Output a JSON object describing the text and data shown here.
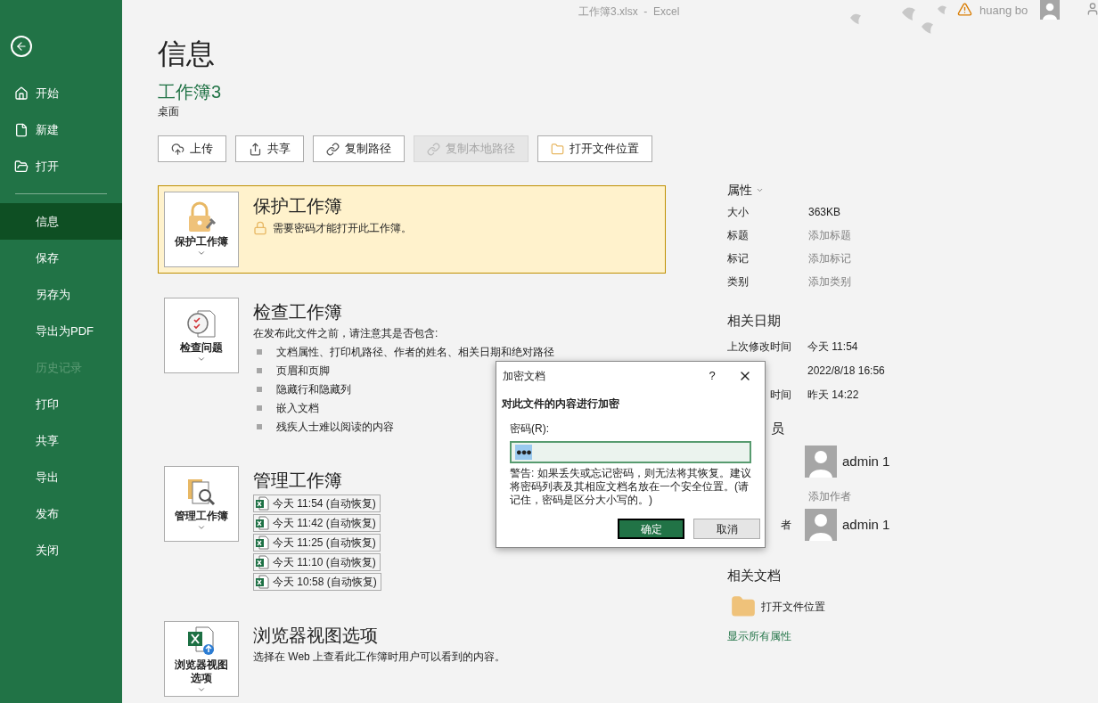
{
  "title_bar": {
    "document_title": "工作簿3.xlsx  -  Excel",
    "user_name": "huang bo"
  },
  "sidebar": {
    "top_items": [
      {
        "label": "开始"
      },
      {
        "label": "新建"
      },
      {
        "label": "打开"
      }
    ],
    "items": [
      {
        "label": "信息",
        "selected": true,
        "disabled": false
      },
      {
        "label": "保存",
        "selected": false,
        "disabled": false
      },
      {
        "label": "另存为",
        "selected": false,
        "disabled": false
      },
      {
        "label": "导出为PDF",
        "selected": false,
        "disabled": false
      },
      {
        "label": "历史记录",
        "selected": false,
        "disabled": true
      },
      {
        "label": "打印",
        "selected": false,
        "disabled": false
      },
      {
        "label": "共享",
        "selected": false,
        "disabled": false
      },
      {
        "label": "导出",
        "selected": false,
        "disabled": false
      },
      {
        "label": "发布",
        "selected": false,
        "disabled": false
      },
      {
        "label": "关闭",
        "selected": false,
        "disabled": false
      }
    ]
  },
  "page_title": "信息",
  "workbook": {
    "name": "工作簿3",
    "location": "桌面"
  },
  "actions": [
    {
      "label": "上传",
      "disabled": false
    },
    {
      "label": "共享",
      "disabled": false
    },
    {
      "label": "复制路径",
      "disabled": false
    },
    {
      "label": "复制本地路径",
      "disabled": true
    },
    {
      "label": "打开文件位置",
      "disabled": false
    }
  ],
  "sections": [
    {
      "kind": "protect",
      "highlighted": true,
      "button_label": "保护工作簿",
      "title": "保护工作簿",
      "note": "需要密码才能打开此工作簿。"
    },
    {
      "kind": "inspect",
      "highlighted": false,
      "button_label": "检查问题",
      "title": "检查工作簿",
      "intro": "在发布此文件之前，请注意其是否包含:",
      "bullets": [
        "文档属性、打印机路径、作者的姓名、相关日期和绝对路径",
        "页眉和页脚",
        "隐藏行和隐藏列",
        "嵌入文档",
        "残疾人士难以阅读的内容"
      ]
    },
    {
      "kind": "manage",
      "highlighted": false,
      "button_label": "管理工作簿",
      "title": "管理工作簿",
      "versions": [
        "今天 11:54 (自动恢复)",
        "今天 11:42 (自动恢复)",
        "今天 11:25 (自动恢复)",
        "今天 11:10 (自动恢复)",
        "今天 10:58 (自动恢复)"
      ]
    },
    {
      "kind": "browser",
      "highlighted": false,
      "button_label": "浏览器视图选项",
      "title": "浏览器视图选项",
      "description": "选择在 Web 上查看此工作簿时用户可以看到的内容。"
    }
  ],
  "properties": {
    "heading": "属性",
    "rows": [
      {
        "label": "大小",
        "value": "363KB",
        "kind": "text"
      },
      {
        "label": "标题",
        "value": "添加标题",
        "kind": "link"
      },
      {
        "label": "标记",
        "value": "添加标记",
        "kind": "link"
      },
      {
        "label": "类别",
        "value": "添加类别",
        "kind": "link"
      }
    ]
  },
  "dates": {
    "heading": "相关日期",
    "rows": [
      {
        "label": "上次修改时间",
        "value": "今天 11:54"
      },
      {
        "value": "2022/8/18 16:56"
      },
      {
        "label_tail": "时间",
        "value": "昨天 14:22"
      }
    ]
  },
  "people": {
    "heading_tail": "员",
    "authors": [
      {
        "name": "admin 1"
      }
    ],
    "add_author": "添加作者",
    "modifier": {
      "label_tail": "者",
      "name": "admin 1"
    }
  },
  "related_docs": {
    "heading": "相关文档",
    "items": [
      "打开文件位置"
    ],
    "show_all": "显示所有属性"
  },
  "dialog": {
    "title": "加密文档",
    "help": "?",
    "heading": "对此文件的内容进行加密",
    "field_label": "密码(R):",
    "password": "●●●",
    "warning": "警告: 如果丢失或忘记密码，则无法将其恢复。建议将密码列表及其相应文档名放在一个安全位置。(请记住，密码是区分大小写的。)",
    "ok": "确定",
    "cancel": "取消"
  }
}
